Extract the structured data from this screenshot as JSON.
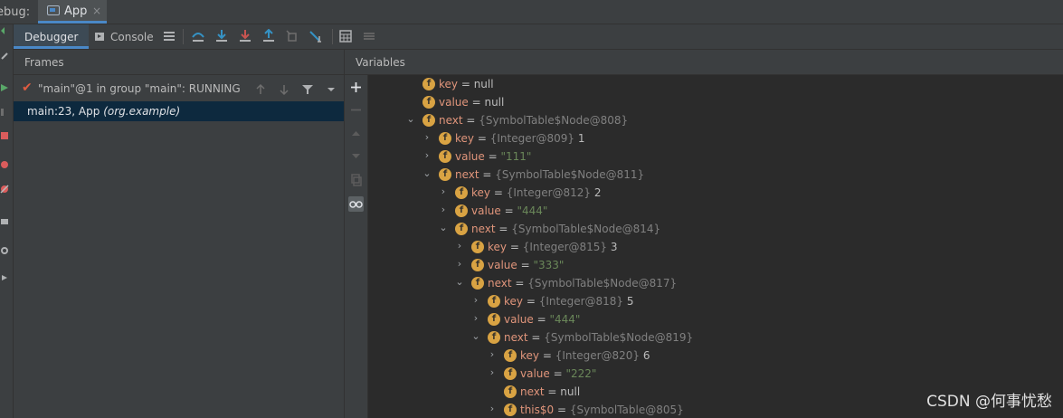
{
  "titlebar": {
    "debug_label": "ebug:",
    "tab_title": "App",
    "tab_close": "×"
  },
  "toolbar": {
    "debugger_tab": "Debugger",
    "console_tab": "Console"
  },
  "frames": {
    "header": "Frames",
    "thread_text": "\"main\"@1 in group \"main\": RUNNING",
    "frame_method": "main:23, App",
    "frame_package": "(org.example)"
  },
  "variables": {
    "header": "Variables",
    "rows": [
      {
        "indent": 0,
        "arrow": "",
        "name": "key",
        "eq": " = ",
        "type": "",
        "value": "null",
        "value_kind": "plain"
      },
      {
        "indent": 0,
        "arrow": "",
        "name": "value",
        "eq": " = ",
        "type": "",
        "value": "null",
        "value_kind": "plain"
      },
      {
        "indent": 0,
        "arrow": "⌄",
        "name": "next",
        "eq": " = ",
        "type": "{SymbolTable$Node@808}",
        "value": "",
        "value_kind": "plain"
      },
      {
        "indent": 1,
        "arrow": "›",
        "name": "key",
        "eq": " = ",
        "type": "{Integer@809}",
        "value": " 1",
        "value_kind": "plain"
      },
      {
        "indent": 1,
        "arrow": "›",
        "name": "value",
        "eq": " = ",
        "type": "",
        "value": "\"111\"",
        "value_kind": "string"
      },
      {
        "indent": 1,
        "arrow": "⌄",
        "name": "next",
        "eq": " = ",
        "type": "{SymbolTable$Node@811}",
        "value": "",
        "value_kind": "plain"
      },
      {
        "indent": 2,
        "arrow": "›",
        "name": "key",
        "eq": " = ",
        "type": "{Integer@812}",
        "value": " 2",
        "value_kind": "plain"
      },
      {
        "indent": 2,
        "arrow": "›",
        "name": "value",
        "eq": " = ",
        "type": "",
        "value": "\"444\"",
        "value_kind": "string"
      },
      {
        "indent": 2,
        "arrow": "⌄",
        "name": "next",
        "eq": " = ",
        "type": "{SymbolTable$Node@814}",
        "value": "",
        "value_kind": "plain"
      },
      {
        "indent": 3,
        "arrow": "›",
        "name": "key",
        "eq": " = ",
        "type": "{Integer@815}",
        "value": " 3",
        "value_kind": "plain"
      },
      {
        "indent": 3,
        "arrow": "›",
        "name": "value",
        "eq": " = ",
        "type": "",
        "value": "\"333\"",
        "value_kind": "string"
      },
      {
        "indent": 3,
        "arrow": "⌄",
        "name": "next",
        "eq": " = ",
        "type": "{SymbolTable$Node@817}",
        "value": "",
        "value_kind": "plain"
      },
      {
        "indent": 4,
        "arrow": "›",
        "name": "key",
        "eq": " = ",
        "type": "{Integer@818}",
        "value": " 5",
        "value_kind": "plain"
      },
      {
        "indent": 4,
        "arrow": "›",
        "name": "value",
        "eq": " = ",
        "type": "",
        "value": "\"444\"",
        "value_kind": "string"
      },
      {
        "indent": 4,
        "arrow": "⌄",
        "name": "next",
        "eq": " = ",
        "type": "{SymbolTable$Node@819}",
        "value": "",
        "value_kind": "plain"
      },
      {
        "indent": 5,
        "arrow": "›",
        "name": "key",
        "eq": " = ",
        "type": "{Integer@820}",
        "value": " 6",
        "value_kind": "plain"
      },
      {
        "indent": 5,
        "arrow": "›",
        "name": "value",
        "eq": " = ",
        "type": "",
        "value": "\"222\"",
        "value_kind": "string"
      },
      {
        "indent": 5,
        "arrow": "",
        "name": "next",
        "eq": " = ",
        "type": "",
        "value": "null",
        "value_kind": "plain"
      },
      {
        "indent": 5,
        "arrow": "›",
        "name": "this$0",
        "eq": " = ",
        "type": "{SymbolTable@805}",
        "value": "",
        "value_kind": "plain"
      }
    ],
    "field_badge": "f"
  },
  "watermark": "CSDN @何事忧愁",
  "colors": {
    "accent": "#4a88c7",
    "field_badge": "#d9a343",
    "var_name": "#e0957b",
    "string": "#6a8759",
    "selection": "#0d293e"
  }
}
